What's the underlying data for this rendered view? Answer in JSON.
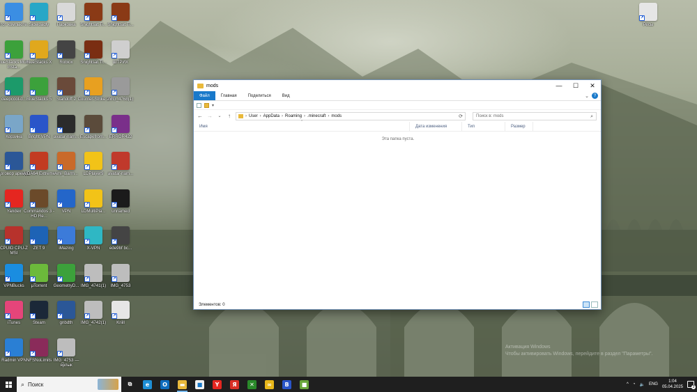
{
  "desktop": {
    "icons": [
      {
        "label": "Этот компьюте...",
        "icon": "computer-icon",
        "color": "#3b8ee3"
      },
      {
        "label": "Sideloadly",
        "icon": "gear-icon",
        "color": "#27a7c7"
      },
      {
        "label": "Парковка",
        "icon": "file-icon",
        "color": "#d9d9d9"
      },
      {
        "label": "Snightsat.Ti...",
        "icon": "game-icon",
        "color": "#8a3a16"
      },
      {
        "label": "Snightsat.Ti...",
        "icon": "game-icon",
        "color": "#8a3a16"
      },
      {
        "label": "BlueStacks Multi-Insta...",
        "icon": "bluestacks-icon",
        "color": "#3ca13b"
      },
      {
        "label": "BlueStacks X",
        "icon": "bluestacks-x-icon",
        "color": "#e0a81d"
      },
      {
        "label": "Roblox",
        "icon": "roblox-icon",
        "color": "#444444"
      },
      {
        "label": "Snightsat.Ti...",
        "icon": "game-icon",
        "color": "#7a2e12"
      },
      {
        "label": "ШТРИХ",
        "icon": "file-icon",
        "color": "#cfcfcf"
      },
      {
        "label": "deepcool-d...",
        "icon": "deepcool-icon",
        "color": "#1c9a6a"
      },
      {
        "label": "BlueStacks 5",
        "icon": "bluestacks-icon",
        "color": "#3ca13b"
      },
      {
        "label": "Standoff 2",
        "icon": "game-icon",
        "color": "#6a4a3a"
      },
      {
        "label": "Counter-Strike 2",
        "icon": "cs-icon",
        "color": "#e8a020"
      },
      {
        "label": "IMG_4768(1)",
        "icon": "image-icon",
        "color": "#9a9a9a"
      },
      {
        "label": "Корзина",
        "icon": "trash-icon",
        "color": "#7aa6c8"
      },
      {
        "label": "Bright VPN",
        "icon": "vpn-icon",
        "color": "#2a55c9"
      },
      {
        "label": "avatar-nam...",
        "icon": "game-icon",
        "color": "#2b2b2b"
      },
      {
        "label": "Escapefrom...",
        "icon": "game-icon",
        "color": "#5b4b3b"
      },
      {
        "label": "ERROR422",
        "icon": "image-icon",
        "color": "#7a2f8a"
      },
      {
        "label": "Договор аренды",
        "icon": "word-icon",
        "color": "#2b5797"
      },
      {
        "label": "AIDA64 Extreme",
        "icon": "aida-icon",
        "color": "#c23b22"
      },
      {
        "label": "Ami_Barm...",
        "icon": "game-icon",
        "color": "#c96a2a"
      },
      {
        "label": "LDPlayer9",
        "icon": "ldplayer-icon",
        "color": "#f2c318"
      },
      {
        "label": "avatar-nam...",
        "icon": "game-icon",
        "color": "#c0392b"
      },
      {
        "label": "Yandex",
        "icon": "yandex-icon",
        "color": "#e52620"
      },
      {
        "label": "Commandos 3 - HD Re...",
        "icon": "game-icon",
        "color": "#6b4a2a"
      },
      {
        "label": "VPN",
        "icon": "vpn-icon",
        "color": "#2466c9"
      },
      {
        "label": "LDMultiPla...",
        "icon": "ldplayer-icon",
        "color": "#f2c318"
      },
      {
        "label": "unnamed",
        "icon": "image-icon",
        "color": "#1b1b1b"
      },
      {
        "label": "CPUID CPU-Z MSI",
        "icon": "cpuz-icon",
        "color": "#b7322c"
      },
      {
        "label": "ZET 9",
        "icon": "zet-icon",
        "color": "#1e63b5"
      },
      {
        "label": "iMazing",
        "icon": "imazing-icon",
        "color": "#3c7bd9"
      },
      {
        "label": "X-VPN",
        "icon": "vpn-icon",
        "color": "#2fb7c4"
      },
      {
        "label": "ede9bf bc...",
        "icon": "image-icon",
        "color": "#444444"
      },
      {
        "label": "VPNBucks",
        "icon": "vpn-icon",
        "color": "#1a8de0"
      },
      {
        "label": "µTorrent",
        "icon": "utorrent-icon",
        "color": "#6cba3b"
      },
      {
        "label": "GeometryD...",
        "icon": "game-icon",
        "color": "#3ca13b"
      },
      {
        "label": "IMG_4741(1)",
        "icon": "image-icon",
        "color": "#bdbdbd"
      },
      {
        "label": "IMG_4753",
        "icon": "image-icon",
        "color": "#bdbdbd"
      },
      {
        "label": "iTunes",
        "icon": "itunes-icon",
        "color": "#e5457a"
      },
      {
        "label": "Steam",
        "icon": "steam-icon",
        "color": "#1b2838"
      },
      {
        "label": "gnbdth",
        "icon": "word-icon",
        "color": "#2b5797"
      },
      {
        "label": "IMG_4742(1)",
        "icon": "image-icon",
        "color": "#bdbdbd"
      },
      {
        "label": "Kriill",
        "icon": "file-icon",
        "color": "#e6e6e6"
      },
      {
        "label": "Radmin VPN",
        "icon": "vpn-icon",
        "color": "#2a7fd4"
      },
      {
        "label": "NFSNoLimits",
        "icon": "game-icon",
        "color": "#8a2b5a"
      },
      {
        "label": "IMG_4753 — ярлык",
        "icon": "image-icon",
        "color": "#bdbdbd"
      },
      {
        "label": "Ресы",
        "icon": "file-icon",
        "color": "#e6e6e6"
      }
    ]
  },
  "explorer": {
    "title": "mods",
    "controls": {
      "minimize": "—",
      "maximize": "☐",
      "close": "✕"
    },
    "ribbon_tabs": [
      "Файл",
      "Главная",
      "Поделиться",
      "Вид"
    ],
    "help": "?",
    "breadcrumb": [
      "User",
      "AppData",
      "Roaming",
      ".minecraft",
      "mods"
    ],
    "search_placeholder": "Поиск в: mods",
    "columns": [
      "Имя",
      "Дата изменения",
      "Тип",
      "Размер"
    ],
    "empty_message": "Эта папка пуста.",
    "status": "Элементов: 0"
  },
  "watermark": {
    "line1": "Активация Windows",
    "line2": "Чтобы активировать Windows, перейдите в раздел \"Параметры\"."
  },
  "taskbar": {
    "search_label": "Поиск",
    "apps": [
      {
        "name": "task-view",
        "glyph": "⧉",
        "color": "#1f1f1f"
      },
      {
        "name": "edge",
        "glyph": "e",
        "color": "#1e8fd6"
      },
      {
        "name": "outlook",
        "glyph": "O",
        "color": "#0f6cbd"
      },
      {
        "name": "file-explorer",
        "glyph": "▬",
        "color": "#e9b93b",
        "active": true
      },
      {
        "name": "store",
        "glyph": "■",
        "color": "#f2f2f2"
      },
      {
        "name": "yandex",
        "glyph": "Y",
        "color": "#e52620"
      },
      {
        "name": "yandex-browser",
        "glyph": "Я",
        "color": "#d93025"
      },
      {
        "name": "xbox",
        "glyph": "✕",
        "color": "#2a8a2a"
      },
      {
        "name": "app-yellow",
        "glyph": "∞",
        "color": "#e8b71a"
      },
      {
        "name": "bright-vpn",
        "glyph": "B",
        "color": "#2a55c9"
      },
      {
        "name": "minecraft",
        "glyph": "■",
        "color": "#6aa63a"
      }
    ],
    "tray": {
      "chevron": "^",
      "lang": "ENG",
      "time": "1:04",
      "date": "05.04.2025",
      "notifications": "3"
    }
  }
}
